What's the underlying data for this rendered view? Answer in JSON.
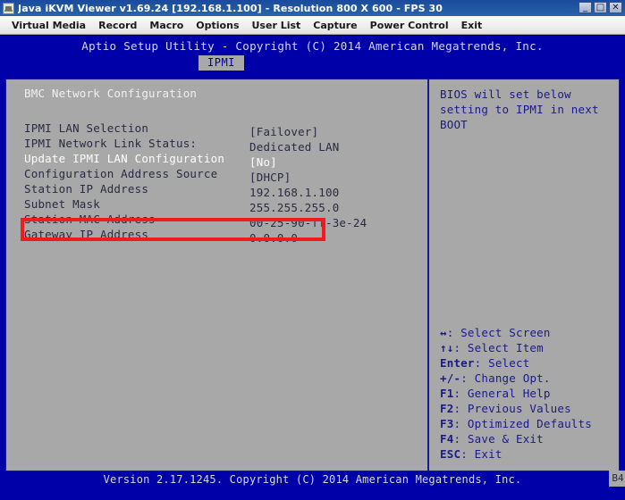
{
  "window": {
    "title": "Java iKVM Viewer v1.69.24 [192.168.1.100] - Resolution 800 X 600 - FPS 30",
    "app_icon": "kvm-app-icon",
    "buttons": {
      "minimize": "_",
      "maximize": "□",
      "close": "✕"
    }
  },
  "menubar": {
    "items": [
      {
        "label": "Virtual Media"
      },
      {
        "label": "Record"
      },
      {
        "label": "Macro"
      },
      {
        "label": "Options"
      },
      {
        "label": "User List"
      },
      {
        "label": "Capture"
      },
      {
        "label": "Power Control"
      },
      {
        "label": "Exit"
      }
    ]
  },
  "bios": {
    "header_title": "Aptio Setup Utility - Copyright (C) 2014 American Megatrends, Inc.",
    "tab": "IPMI",
    "section_title": "BMC Network Configuration",
    "settings": [
      {
        "label": "IPMI LAN Selection",
        "value": "[Failover]",
        "selected": false
      },
      {
        "label": "IPMI Network Link Status:",
        "value": "Dedicated LAN",
        "selected": false
      },
      {
        "label": "Update IPMI LAN Configuration",
        "value": "[No]",
        "selected": true
      },
      {
        "label": "Configuration Address Source",
        "value": "[DHCP]",
        "selected": false
      },
      {
        "label": "Station IP Address",
        "value": "192.168.1.100",
        "selected": false
      },
      {
        "label": "Subnet Mask",
        "value": "255.255.255.0",
        "selected": false
      },
      {
        "label": "Station MAC Address",
        "value": "00-25-90-ff-3e-24",
        "selected": false
      },
      {
        "label": "Gateway IP Address",
        "value": "0.0.0.0",
        "selected": false
      }
    ],
    "help_text": "BIOS will set below setting to IPMI in next BOOT",
    "key_help": [
      {
        "key": "↔",
        "desc": ": Select Screen"
      },
      {
        "key": "↑↓",
        "desc": ": Select Item"
      },
      {
        "key": "Enter",
        "desc": ": Select"
      },
      {
        "key": "+/-",
        "desc": ": Change Opt."
      },
      {
        "key": "F1",
        "desc": ": General Help"
      },
      {
        "key": "F2",
        "desc": ": Previous Values"
      },
      {
        "key": "F3",
        "desc": ": Optimized Defaults"
      },
      {
        "key": "F4",
        "desc": ": Save & Exit"
      },
      {
        "key": "ESC",
        "desc": ": Exit"
      }
    ],
    "footer_text": "Version 2.17.1245. Copyright (C) 2014 American Megatrends, Inc.",
    "footer_badge": "B4"
  },
  "annotation": {
    "highlight_color": "#ee1c1c",
    "target_label": "Update IPMI LAN Configuration"
  },
  "colors": {
    "bios_blue": "#0000a8",
    "bios_panel_gray": "#a8a8a8",
    "bios_text_dark": "#2a2a42",
    "bios_help_blue": "#1a1a8c",
    "titlebar_blue": "#20569f"
  }
}
